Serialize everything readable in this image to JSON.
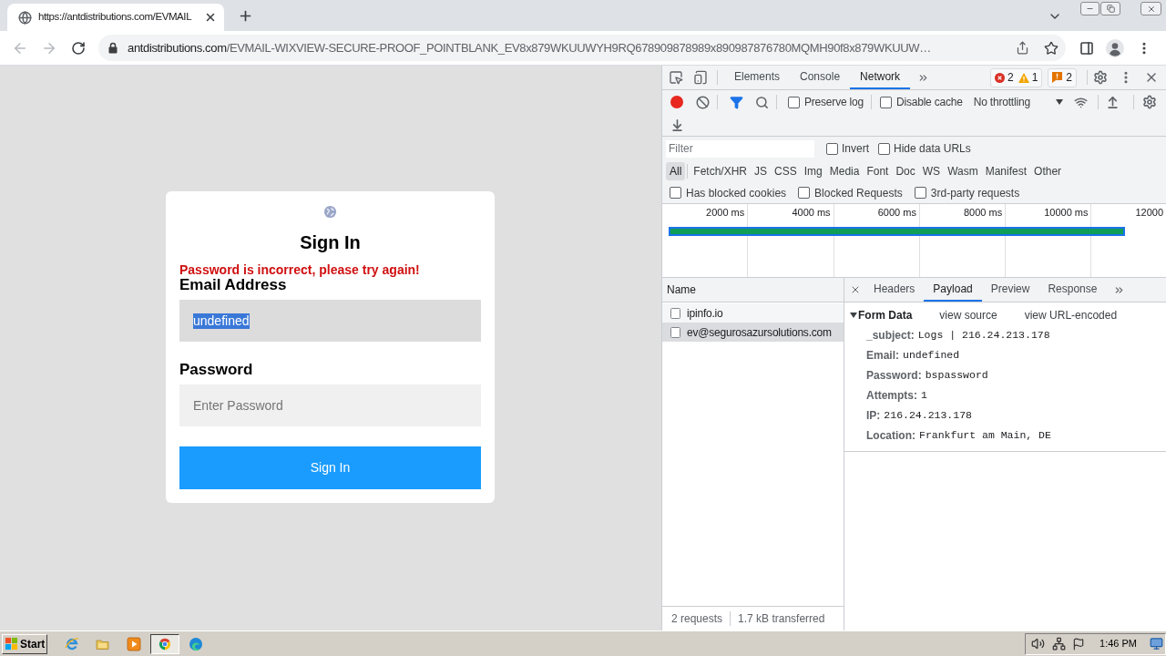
{
  "browser": {
    "tab": {
      "title": "https://antdistributions.com/EVMAIL",
      "selected": true
    },
    "address": {
      "host": "antdistributions.com",
      "path": "/EVMAIL-WIXVIEW-SECURE-PROOF_POINTBLANK_EV8x879WKUUWYH9RQ678909878989x890987876780MQMH90f8x879WKUUW…"
    }
  },
  "page": {
    "card": {
      "title": "Sign In",
      "error": "Password is incorrect, please try again!",
      "fields": [
        {
          "label": "Email Address",
          "value": "undefined",
          "focused": true,
          "text_selected": true
        },
        {
          "label": "Password",
          "placeholder": "Enter Password",
          "focused": false
        }
      ],
      "button": "Sign In"
    }
  },
  "devtools": {
    "tabs": [
      {
        "label": "Elements",
        "selected": false
      },
      {
        "label": "Console",
        "selected": false
      },
      {
        "label": "Network",
        "selected": true
      }
    ],
    "counts": {
      "errors": "2",
      "warnings": "1",
      "issues": "2"
    },
    "toolbar": {
      "recording": true,
      "options": [
        {
          "label": "Preserve log",
          "checked": false
        },
        {
          "label": "Disable cache",
          "checked": false
        }
      ],
      "throttling": "No throttling"
    },
    "filter": {
      "placeholder": "Filter",
      "options": [
        {
          "label": "Invert",
          "checked": false
        },
        {
          "label": "Hide data URLs",
          "checked": false
        }
      ]
    },
    "types": [
      {
        "label": "All",
        "selected": true
      },
      {
        "label": "Fetch/XHR",
        "selected": false
      },
      {
        "label": "JS",
        "selected": false
      },
      {
        "label": "CSS",
        "selected": false
      },
      {
        "label": "Img",
        "selected": false
      },
      {
        "label": "Media",
        "selected": false
      },
      {
        "label": "Font",
        "selected": false
      },
      {
        "label": "Doc",
        "selected": false
      },
      {
        "label": "WS",
        "selected": false
      },
      {
        "label": "Wasm",
        "selected": false
      },
      {
        "label": "Manifest",
        "selected": false
      },
      {
        "label": "Other",
        "selected": false
      }
    ],
    "request_filters": [
      {
        "label": "Has blocked cookies",
        "checked": false
      },
      {
        "label": "Blocked Requests",
        "checked": false
      },
      {
        "label": "3rd-party requests",
        "checked": false
      }
    ],
    "overview": {
      "ticks": [
        "2000 ms",
        "4000 ms",
        "6000 ms",
        "8000 ms",
        "10000 ms",
        "12000"
      ]
    },
    "requests": {
      "column": "Name",
      "rows": [
        {
          "name": "ipinfo.io",
          "selected": false
        },
        {
          "name": "ev@segurosazursolutions.com",
          "selected": true
        }
      ],
      "count": "2 requests",
      "transferred": "1.7 kB transferred"
    },
    "details": {
      "tabs": [
        {
          "label": "Headers",
          "selected": false
        },
        {
          "label": "Payload",
          "selected": true
        },
        {
          "label": "Preview",
          "selected": false
        },
        {
          "label": "Response",
          "selected": false
        }
      ],
      "section": {
        "title": "Form Data",
        "expanded": true,
        "links": [
          "view source",
          "view URL-encoded"
        ],
        "fields": [
          {
            "key": "_subject:",
            "value": "Logs | 216.24.213.178"
          },
          {
            "key": "Email:",
            "value": "undefined"
          },
          {
            "key": "Password:",
            "value": "bspassword"
          },
          {
            "key": "Attempts:",
            "value": "1"
          },
          {
            "key": "IP:",
            "value": "216.24.213.178"
          },
          {
            "key": "Location:",
            "value": "Frankfurt am Main, DE"
          }
        ]
      }
    }
  },
  "taskbar": {
    "start": "Start",
    "apps": [
      {
        "kind": "ie",
        "selected": false
      },
      {
        "kind": "folder",
        "selected": false
      },
      {
        "kind": "media",
        "selected": false
      },
      {
        "kind": "chrome",
        "selected": true
      },
      {
        "kind": "edge",
        "selected": false
      }
    ],
    "clock": "1:46 PM"
  }
}
